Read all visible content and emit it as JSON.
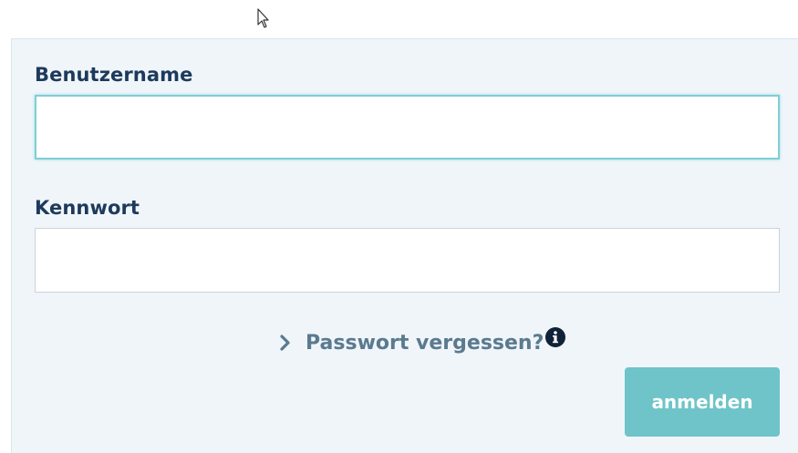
{
  "form": {
    "username_label": "Benutzername",
    "username_value": "",
    "password_label": "Kennwort",
    "password_value": "",
    "forgot_link": "Passwort vergessen?",
    "submit_label": "anmelden"
  },
  "icons": {
    "cursor": "mouse-pointer-icon",
    "forgot_chevron": "chevron-right-icon",
    "info": "info-circle-icon"
  },
  "colors": {
    "label": "#1d3a5c",
    "link": "#5a7a8f",
    "button": "#6ec4c9",
    "focus_border": "#7ecfd6",
    "panel": "#f0f5f9"
  }
}
